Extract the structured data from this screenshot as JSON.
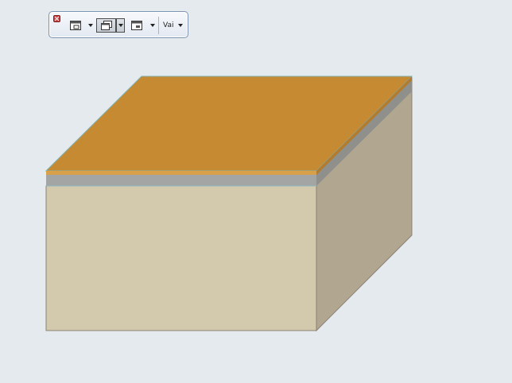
{
  "toolbar": {
    "close_icon": "close-icon",
    "buttons": [
      {
        "icon": "view-window-icon",
        "active": false
      },
      {
        "icon": "view-tiles-icon",
        "active": true
      },
      {
        "icon": "view-panel-icon",
        "active": false
      }
    ],
    "go_label": "Vai"
  },
  "scene": {
    "object": "box",
    "colors": {
      "top": "#c68a33",
      "top_stripe": "#d9a04a",
      "layer_gray": "#a3a5a4",
      "layer_edge": "#8fb8bf",
      "front": "#d3c9ad",
      "side": "#b1a690",
      "side_top_gray": "#8f8f8c",
      "outline": "#8b8377",
      "background": "#e4eaed"
    }
  }
}
